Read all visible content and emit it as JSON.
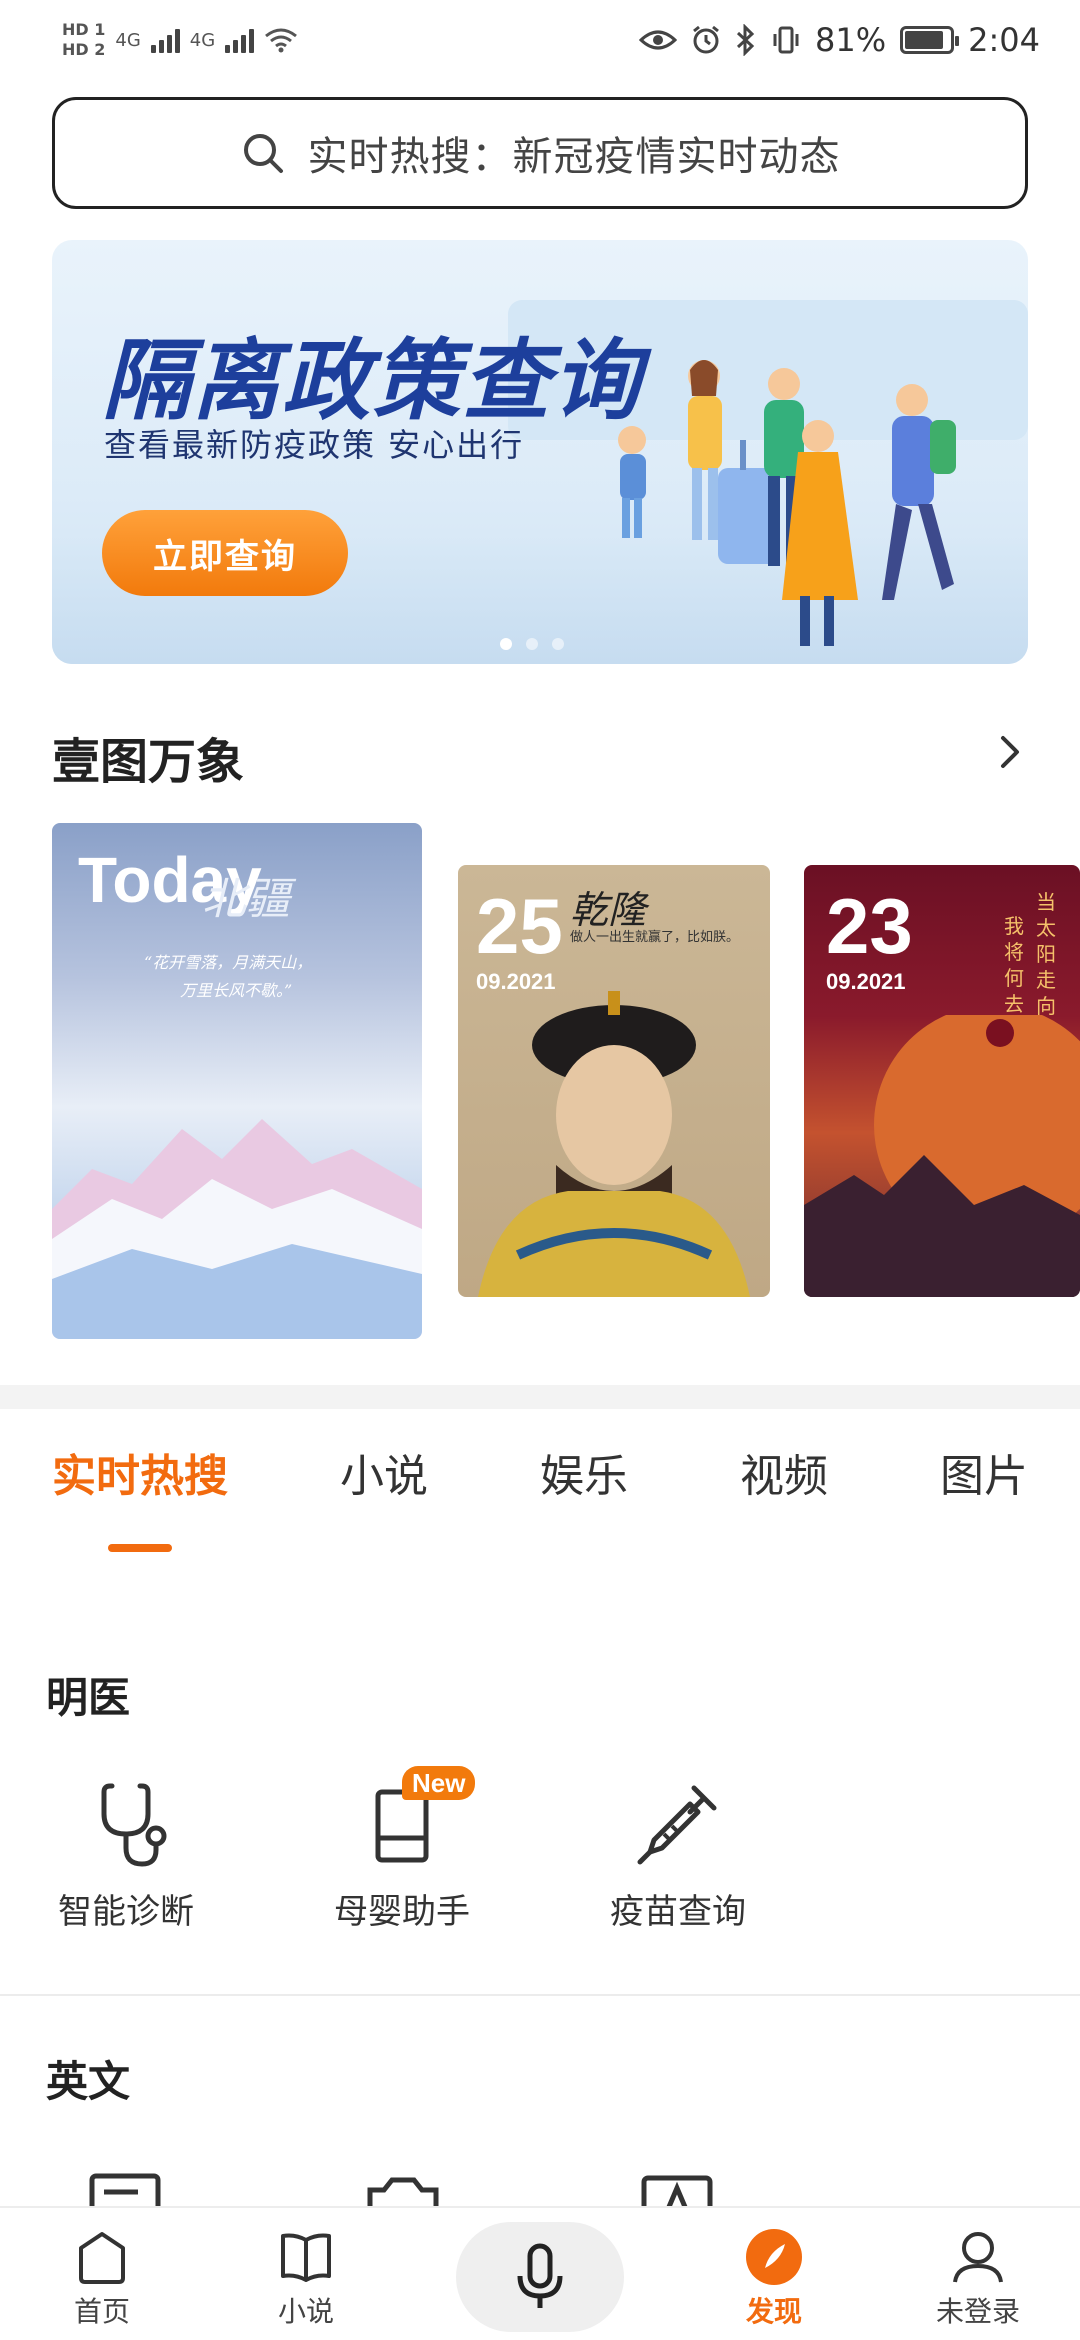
{
  "status_bar": {
    "sim1": "HD 1",
    "sim2": "HD 2",
    "net1": "4G",
    "net2": "4G",
    "battery": "81%",
    "time": "2:04"
  },
  "search": {
    "placeholder": "实时热搜：新冠疫情实时动态"
  },
  "banner": {
    "title": "隔离政策查询",
    "subtitle": "查看最新防疫政策  安心出行",
    "button": "立即查询",
    "dots": 3,
    "active_dot": 0
  },
  "gallery": {
    "title": "壹图万象",
    "cards": [
      {
        "big": "Today",
        "text": "北疆",
        "poem1": "“花开雪落，月满天山，",
        "poem2": "万里长风不歇。”"
      },
      {
        "big": "25",
        "date": "09.2021",
        "text": "乾隆",
        "caption": "做人一出生就赢了，比如朕。"
      },
      {
        "big": "23",
        "date": "09.2021",
        "text": "当太阳走向衰亡，",
        "text2": "我将何去何从？"
      }
    ]
  },
  "tabs": [
    {
      "label": "实时热搜",
      "active": true
    },
    {
      "label": "小说",
      "active": false
    },
    {
      "label": "娱乐",
      "active": false
    },
    {
      "label": "视频",
      "active": false
    },
    {
      "label": "图片",
      "active": false
    }
  ],
  "groups": {
    "medical": {
      "title": "明医",
      "tools": [
        {
          "label": "智能诊断",
          "icon": "stethoscope-icon"
        },
        {
          "label": "母婴助手",
          "icon": "tablet-icon",
          "badge": "New"
        },
        {
          "label": "疫苗查询",
          "icon": "syringe-icon"
        }
      ]
    },
    "english": {
      "title": "英文"
    }
  },
  "bottom_nav": [
    {
      "label": "首页",
      "icon": "home-icon",
      "active": false
    },
    {
      "label": "小说",
      "icon": "book-icon",
      "active": false
    },
    {
      "label": "",
      "icon": "mic-icon",
      "active": false
    },
    {
      "label": "发现",
      "icon": "discover-icon",
      "active": true
    },
    {
      "label": "未登录",
      "icon": "user-icon",
      "active": false
    }
  ],
  "colors": {
    "accent": "#f26b0f",
    "banner_title": "#1d3f9c",
    "banner_button": "#f27a0c"
  }
}
